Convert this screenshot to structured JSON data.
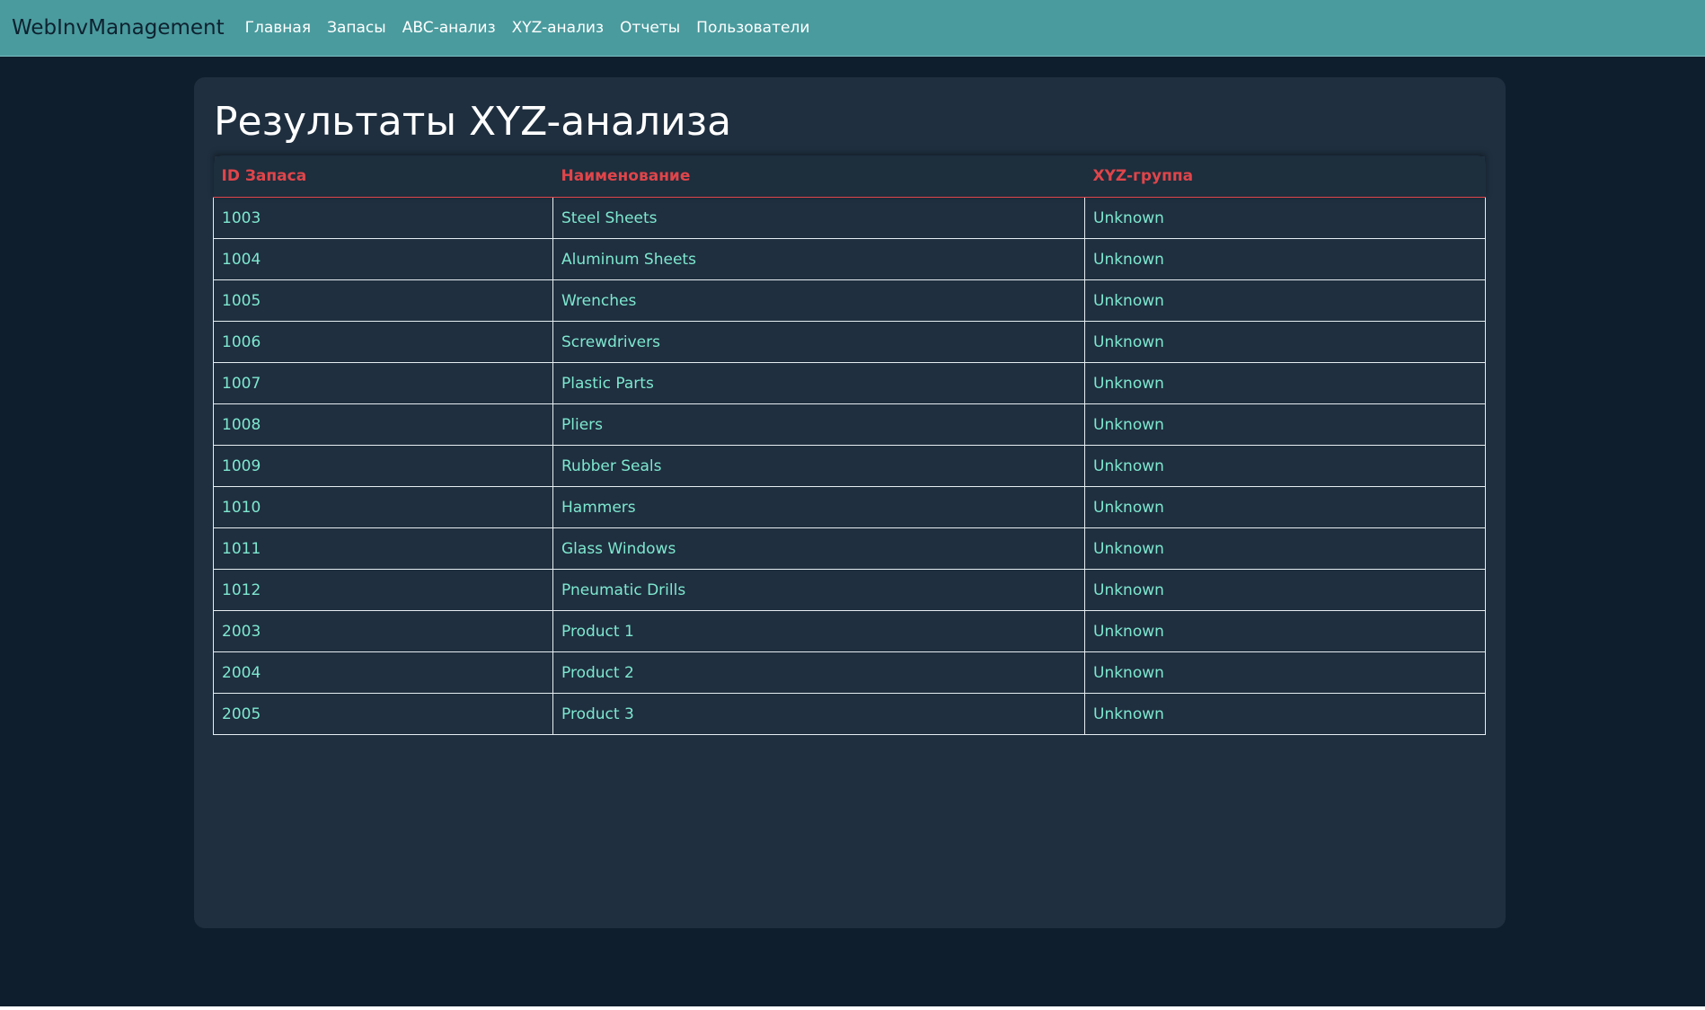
{
  "navbar": {
    "brand": "WebInvManagement",
    "links": [
      {
        "label": "Главная"
      },
      {
        "label": "Запасы"
      },
      {
        "label": "ABC-анализ"
      },
      {
        "label": "XYZ-анализ"
      },
      {
        "label": "Отчеты"
      },
      {
        "label": "Пользователи"
      }
    ]
  },
  "colors": {
    "navbar_bg": "#4a9b9e",
    "page_bg": "#0e1e2c",
    "card_bg": "#1f2f3f",
    "header_text": "#e0454a",
    "cell_text": "#7ee8d0"
  },
  "main": {
    "title": "Результаты XYZ-анализа",
    "table": {
      "columns": [
        "ID Запаса",
        "Наименование",
        "XYZ-группа"
      ],
      "rows": [
        [
          "1003",
          "Steel Sheets",
          "Unknown"
        ],
        [
          "1004",
          "Aluminum Sheets",
          "Unknown"
        ],
        [
          "1005",
          "Wrenches",
          "Unknown"
        ],
        [
          "1006",
          "Screwdrivers",
          "Unknown"
        ],
        [
          "1007",
          "Plastic Parts",
          "Unknown"
        ],
        [
          "1008",
          "Pliers",
          "Unknown"
        ],
        [
          "1009",
          "Rubber Seals",
          "Unknown"
        ],
        [
          "1010",
          "Hammers",
          "Unknown"
        ],
        [
          "1011",
          "Glass Windows",
          "Unknown"
        ],
        [
          "1012",
          "Pneumatic Drills",
          "Unknown"
        ],
        [
          "2003",
          "Product 1",
          "Unknown"
        ],
        [
          "2004",
          "Product 2",
          "Unknown"
        ],
        [
          "2005",
          "Product 3",
          "Unknown"
        ]
      ]
    }
  }
}
